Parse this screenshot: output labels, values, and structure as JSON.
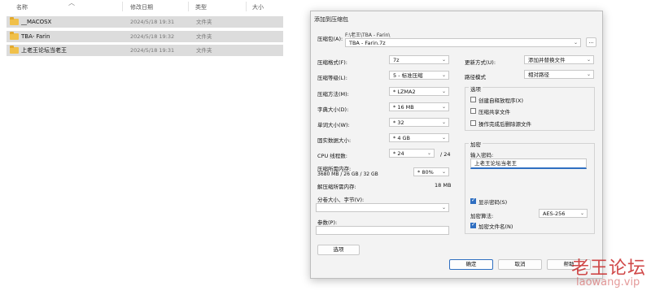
{
  "explorer": {
    "columns": {
      "name": "名称",
      "modified": "修改日期",
      "type": "类型",
      "size": "大小"
    },
    "files": [
      {
        "name": "__MACOSX",
        "modified": "2024/5/18 19:31",
        "type": "文件夹"
      },
      {
        "name": "TBA- Farin",
        "modified": "2024/5/18 19:32",
        "type": "文件夹"
      },
      {
        "name": "上老王论坛当老王",
        "modified": "2024/5/18 19:31",
        "type": "文件夹"
      }
    ]
  },
  "dialog": {
    "title": "添加到压缩包",
    "archive_label": "压缩包(A):",
    "archive_path": "F:\\老王\\TBA - Farin\\",
    "archive_name": "TBA - Farin.7z",
    "browse_label": "...",
    "format_label": "压缩格式(F):",
    "format_value": "7z",
    "level_label": "压缩等级(L):",
    "level_value": "5 - 标准压缩",
    "method_label": "压缩方法(M):",
    "method_value": "* LZMA2",
    "dict_label": "字典大小(D):",
    "dict_value": "* 16 MB",
    "word_label": "单词大小(W):",
    "word_value": "* 32",
    "solid_label": "固实数据大小:",
    "solid_value": "* 4 GB",
    "cpu_label": "CPU 线程数:",
    "cpu_value": "* 24",
    "cpu_total": "/ 24",
    "mem_label": "压缩所需内存:",
    "mem_detail": "3680 MB / 26 GB / 32 GB",
    "mem_value": "* 80%",
    "decomp_label": "解压缩所需内存:",
    "decomp_value": "18 MB",
    "split_label": "分卷大小、字节(V):",
    "split_value": "",
    "params_label": "参数(P):",
    "params_value": "",
    "options_button": "选项",
    "update_label": "更新方式(U):",
    "update_value": "添加并替换文件",
    "pathmode_label": "路径模式",
    "pathmode_value": "相对路径",
    "options_group": "选项",
    "opt_sfx": "创建自释放程序(X)",
    "opt_shared": "压缩共享文件",
    "opt_delete": "操作完成后删除源文件",
    "encrypt_group": "加密",
    "password_label": "输入密码:",
    "password_value": "上老王论坛当老王",
    "show_password": "显示密码(S)",
    "enc_method_label": "加密算法:",
    "enc_method_value": "AES-256",
    "encrypt_names": "加密文件名(N)",
    "ok": "确定",
    "cancel": "取消",
    "help": "帮助"
  },
  "watermark": {
    "line1": "老王论坛",
    "line2": "laowang.vip"
  }
}
